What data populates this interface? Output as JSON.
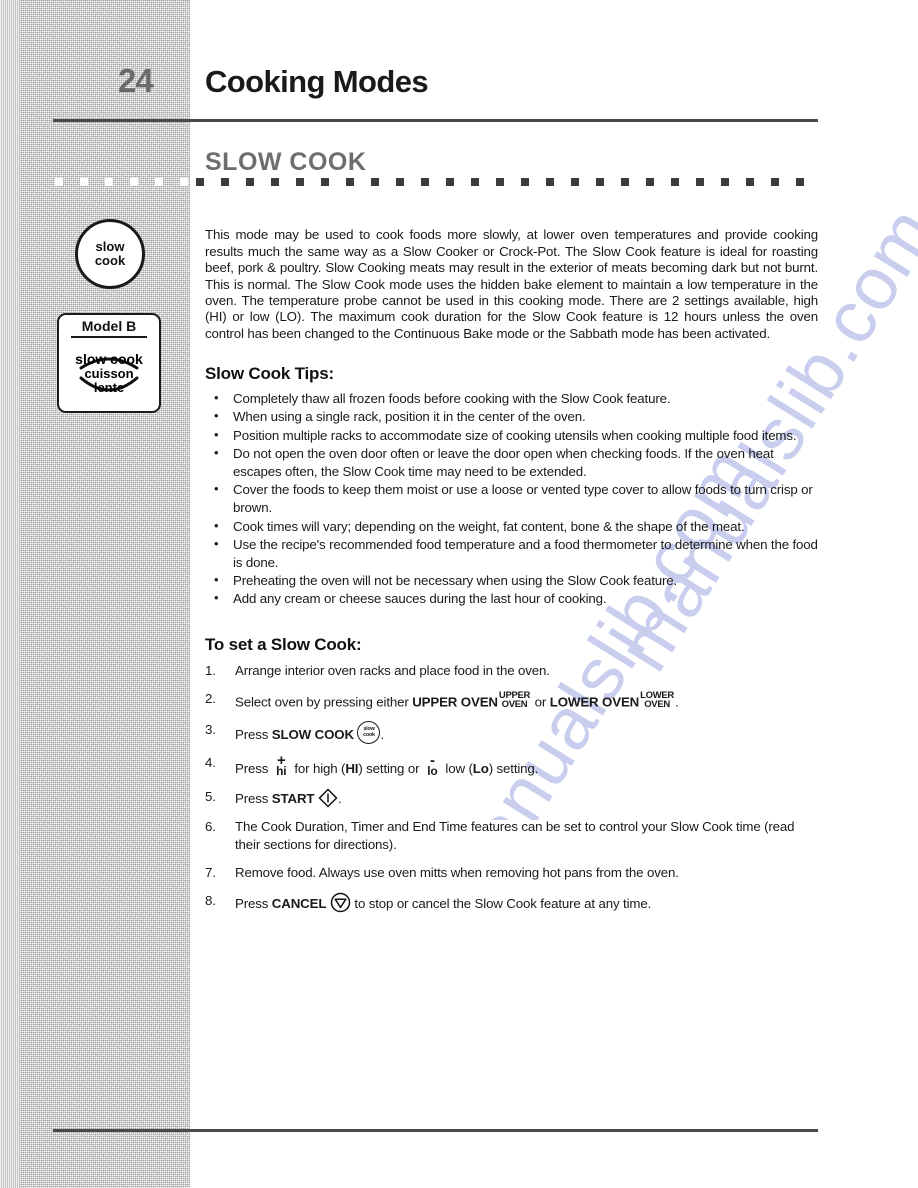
{
  "page": {
    "number": "24",
    "title": "Cooking Modes",
    "section_title": "SLOW COOK"
  },
  "sidebar": {
    "knob": {
      "line1": "slow",
      "line2": "cook"
    },
    "model_box": {
      "model_label": "Model B",
      "line1": "slow cook",
      "line2": "cuisson",
      "line3": "lente"
    }
  },
  "main": {
    "intro": "This mode may be used to cook foods more slowly, at lower oven temperatures and provide cooking results much the same way as a Slow Cooker or Crock-Pot. The Slow Cook feature is ideal for roasting beef, pork & poultry. Slow Cooking meats may result in the exterior of meats becoming dark but not burnt. This is normal. The Slow Cook mode uses the hidden bake element to maintain a low temperature in the oven. The temperature probe cannot be used in this cooking mode. There are 2 settings available, high (HI) or low (LO). The maximum cook duration for the Slow Cook feature is 12 hours unless the oven control has been changed to the Continuous Bake mode or the Sabbath mode has been activated.",
    "tips_heading": "Slow Cook Tips:",
    "tips": [
      "Completely thaw all frozen foods before cooking with the Slow Cook feature.",
      "When using a single rack, position it in the center of the oven.",
      "Position multiple racks to accommodate size of cooking utensils when cooking multiple food items.",
      "Do not open the oven door often or leave the door open when checking foods. If the oven heat escapes often, the Slow Cook time may need to be extended.",
      "Cover the foods to keep them moist or use a loose or vented type cover to allow foods to turn crisp or brown.",
      "Cook times will vary; depending on the weight, fat content, bone & the shape of the meat.",
      "Use the recipe's recommended food temperature and a food thermometer to determine when the food is done.",
      "Preheating the oven will not be necessary when using the Slow Cook feature.",
      "Add any cream or cheese sauces during the last hour of cooking."
    ],
    "steps_heading": "To set a Slow Cook:",
    "steps": {
      "n1": "1.",
      "s1": "Arrange interior oven racks and place food in the oven.",
      "n2": "2.",
      "s2_a": "Select oven by pressing either ",
      "s2_b": "UPPER OVEN",
      "s2_upper_glyph_top": "UPPER",
      "s2_upper_glyph_bot": "OVEN",
      "s2_c": " or ",
      "s2_d": "LOWER OVEN",
      "s2_lower_glyph_top": "LOWER",
      "s2_lower_glyph_bot": "OVEN",
      "s2_e": ".",
      "n3": "3.",
      "s3_a": "Press ",
      "s3_b": "SLOW COOK",
      "s3_icon_a": "slow",
      "s3_icon_b": "cook",
      "s3_c": ".",
      "n4": "4.",
      "s4_a": "Press ",
      "s4_plus": "+",
      "s4_hi": "hi",
      "s4_b": " for high (",
      "s4_hi_bold": "HI",
      "s4_c": ") setting or ",
      "s4_minus": "-",
      "s4_lo": "lo",
      "s4_d": " low (",
      "s4_lo_bold": "Lo",
      "s4_e": ") setting.",
      "n5": "5.",
      "s5_a": "Press ",
      "s5_b": "START",
      "s5_c": ".",
      "n6": "6.",
      "s6": "The Cook Duration, Timer and End Time features can be set to control your Slow Cook time (read their sections for directions).",
      "n7": "7.",
      "s7": "Remove food. Always use oven mitts when removing hot pans from the oven.",
      "n8": "8.",
      "s8_a": "Press ",
      "s8_b": "CANCEL",
      "s8_c": " to stop or cancel the Slow Cook feature at any time."
    }
  },
  "watermark": {
    "line1": "manualslib.com",
    "line2": "manualslib.com"
  },
  "colors": {
    "rule": "#4a4a4a",
    "section_title": "#6e6e6e",
    "page_number": "#6a6a6a",
    "band": "#d2d2d2",
    "watermark": "#c9cdee"
  }
}
